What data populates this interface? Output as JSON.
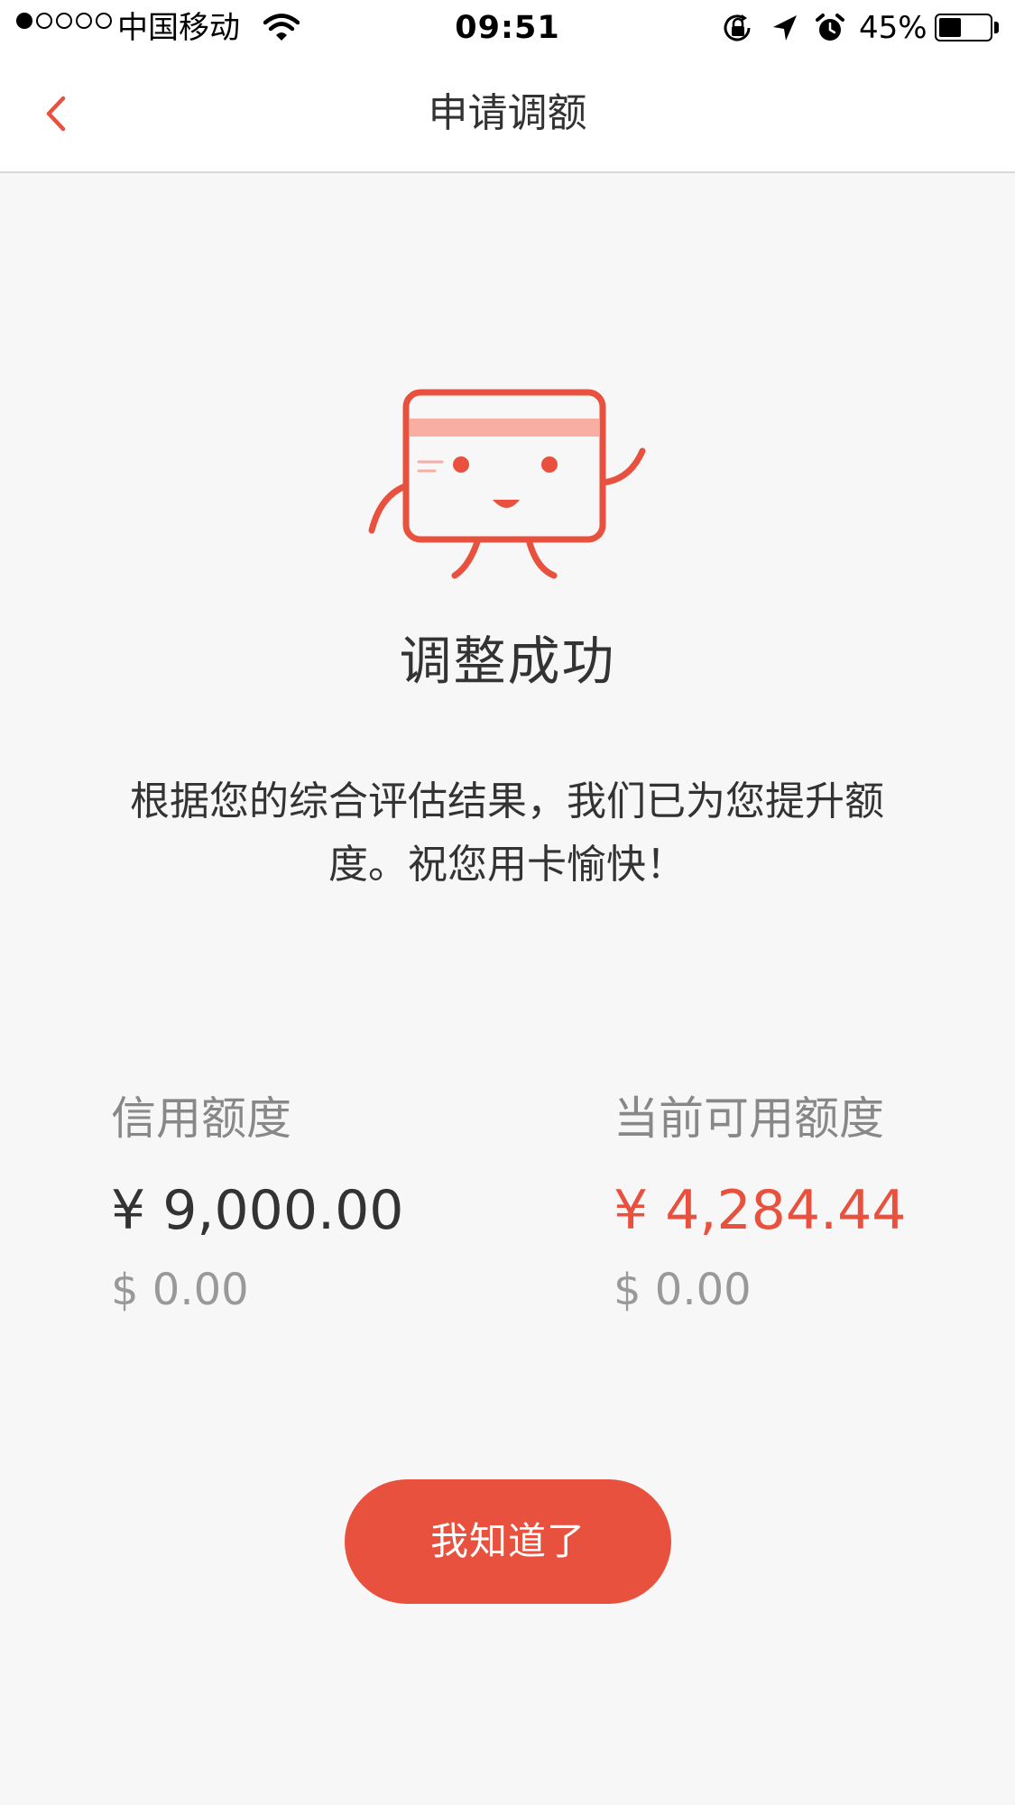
{
  "status_bar": {
    "carrier": "中国移动",
    "time": "09:51",
    "battery_percent_text": "45%",
    "battery_level": 0.45,
    "signal_bars": 1,
    "signal_bars_total": 5
  },
  "nav": {
    "title": "申请调额",
    "back_icon": "chevron-left-icon"
  },
  "result": {
    "title": "调整成功",
    "description": "根据您的综合评估结果，我们已为您提升额度。祝您用卡愉快！"
  },
  "limits": {
    "credit": {
      "label": "信用额度",
      "cny": "¥ 9,000.00",
      "usd": "$ 0.00"
    },
    "available": {
      "label": "当前可用额度",
      "cny": "¥ 4,284.44",
      "usd": "$ 0.00"
    }
  },
  "button": {
    "label": "我知道了"
  },
  "colors": {
    "accent": "#e9513f",
    "accent_light": "#f9aea4",
    "background": "#f7f7f7"
  }
}
